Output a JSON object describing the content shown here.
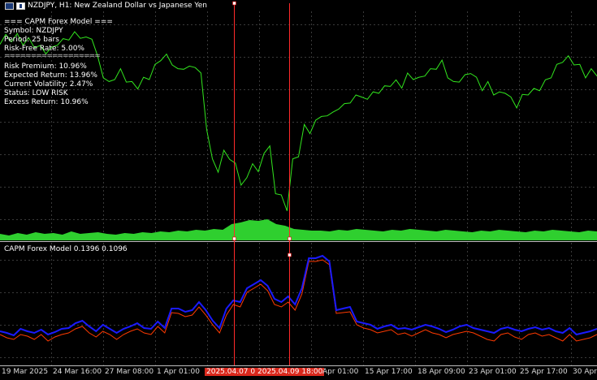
{
  "chart_header": {
    "title": "NZDJPY, H1:  New Zealand Dollar vs Japanese Yen"
  },
  "capm_panel": {
    "header": "=== CAPM Forex Model ===",
    "symbol": "Symbol: NZDJPY",
    "period": "Period: 25 bars",
    "risk_free_rate": "Risk-Free Rate: 5.00%",
    "separator": "==================",
    "risk_premium": "Risk Premium: 10.96%",
    "expected_return": "Expected Return: 13.96%",
    "current_volatility": "Current Volatility: 2.47%",
    "status": "Status: LOW RISK",
    "excess_return": "Excess Return: 10.96%"
  },
  "indicator": {
    "title": "CAPM Forex Model 0.1396 0.1096"
  },
  "x_axis": {
    "labels": [
      "19 Mar 2025",
      "24 Mar 16:00",
      "27 Mar 08:00",
      "1 Apr 01:00",
      "2025.04.07 01:",
      "2025.04.09 18:00",
      "Apr 01:00",
      "15 Apr 17:00",
      "18 Apr 09:00",
      "23 Apr 01:00",
      "25 Apr 17:00",
      "30 Apr"
    ],
    "highlighted": [
      4,
      5
    ]
  },
  "colors": {
    "background": "#000000",
    "price_line": "#32e61e",
    "volume": "#2fcf2f",
    "indicator_main": "#1a1aff",
    "indicator_signal": "#ff3a00",
    "vertical_marker": "#ff2a2a"
  },
  "series": {
    "price": [
      51,
      45,
      48,
      44,
      52,
      49,
      55,
      58,
      62,
      60,
      52,
      50,
      46,
      42,
      44,
      48,
      45,
      70,
      90,
      100,
      92,
      85,
      95,
      100,
      103,
      95,
      92,
      80,
      70,
      68,
      75,
      85,
      80,
      82,
      78,
      90,
      150,
      190,
      200,
      180,
      185,
      195,
      215,
      212,
      190,
      205,
      178,
      175,
      225,
      232,
      245,
      190,
      182,
      150,
      155,
      145,
      135,
      140,
      130,
      132,
      120,
      125,
      110,
      118,
      115,
      112,
      108,
      105,
      100,
      98,
      102,
      90,
      92,
      95,
      88,
      85,
      80,
      75,
      90,
      100,
      95,
      92,
      85,
      95,
      105,
      100,
      110,
      112,
      108,
      118,
      125,
      115,
      110,
      108,
      105,
      98,
      90,
      80,
      72,
      70,
      75,
      80,
      90,
      85,
      88
    ],
    "volume": [
      8,
      6,
      9,
      7,
      10,
      8,
      9,
      7,
      11,
      8,
      9,
      10,
      8,
      7,
      9,
      8,
      10,
      9,
      11,
      10,
      12,
      11,
      13,
      12,
      14,
      13,
      20,
      22,
      25,
      24,
      26,
      20,
      18,
      14,
      13,
      12,
      12,
      11,
      13,
      12,
      14,
      13,
      12,
      11,
      13,
      12,
      14,
      13,
      12,
      11,
      13,
      12,
      11,
      10,
      12,
      11,
      13,
      12,
      11,
      10,
      12,
      11,
      13,
      12,
      11,
      10,
      12,
      11
    ],
    "ind_main": [
      408,
      410,
      413,
      405,
      408,
      410,
      406,
      412,
      409,
      405,
      404,
      398,
      395,
      402,
      408,
      400,
      405,
      410,
      405,
      402,
      398,
      404,
      405,
      396,
      404,
      380,
      380,
      384,
      382,
      372,
      382,
      395,
      404,
      380,
      370,
      372,
      355,
      350,
      345,
      352,
      368,
      372,
      365,
      375,
      355,
      318,
      318,
      315,
      322,
      382,
      380,
      378,
      396,
      398,
      400,
      405,
      402,
      400,
      405,
      404,
      406,
      403,
      400,
      402,
      405,
      409,
      406,
      402,
      400,
      404,
      406,
      408,
      410,
      405,
      403,
      406,
      408,
      405,
      403,
      406,
      404,
      408,
      410,
      404,
      412,
      410,
      408,
      405
    ],
    "ind_signal": [
      412,
      416,
      418,
      412,
      414,
      418,
      412,
      420,
      415,
      412,
      410,
      405,
      402,
      410,
      415,
      408,
      412,
      418,
      412,
      408,
      405,
      410,
      412,
      402,
      410,
      385,
      386,
      390,
      388,
      378,
      388,
      400,
      410,
      388,
      375,
      378,
      360,
      355,
      350,
      358,
      375,
      378,
      372,
      382,
      362,
      322,
      322,
      320,
      326,
      386,
      385,
      384,
      400,
      404,
      406,
      410,
      408,
      406,
      412,
      410,
      414,
      410,
      406,
      410,
      412,
      416,
      412,
      410,
      408,
      410,
      414,
      418,
      420,
      412,
      410,
      415,
      418,
      412,
      410,
      414,
      412,
      416,
      420,
      412,
      420,
      418,
      416,
      412
    ]
  }
}
